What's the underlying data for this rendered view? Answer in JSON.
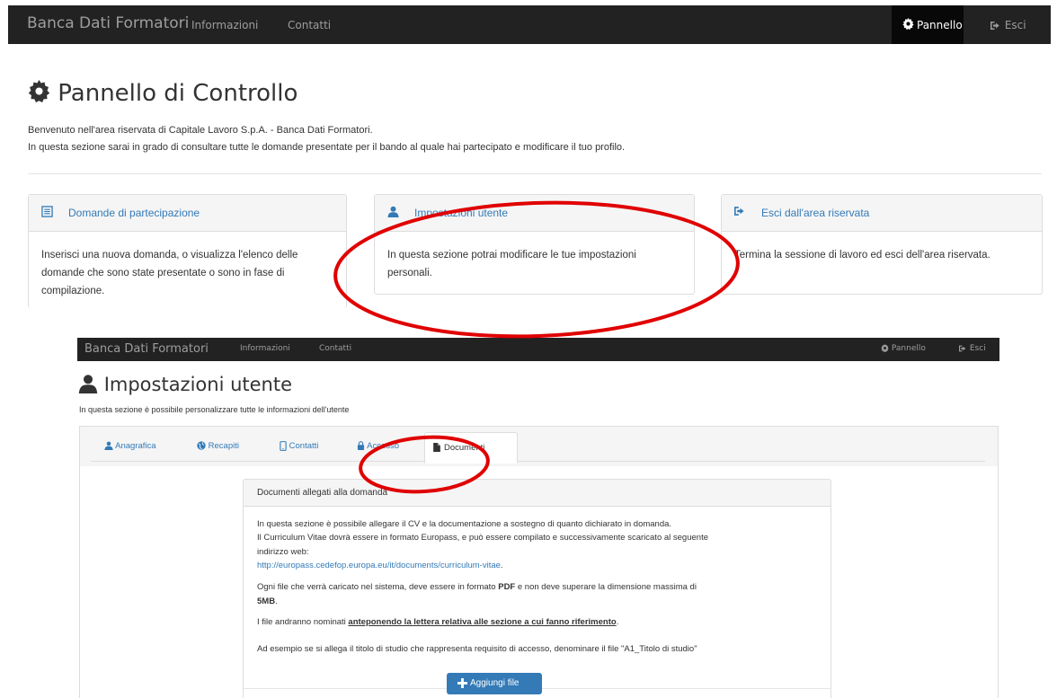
{
  "top": {
    "nav": {
      "brand": "Banca Dati Formatori",
      "links": [
        "Informazioni",
        "Contatti"
      ],
      "pannello": "Pannello",
      "esci": "Esci"
    },
    "title": "Pannello di Controllo",
    "intro_line1": "Benvenuto nell'area riservata di Capitale Lavoro S.p.A. - Banca Dati Formatori.",
    "intro_line2": "In questa sezione sarai in grado di consultare tutte le domande presentate per il bando al quale hai partecipato e modificare il tuo profilo.",
    "panels": [
      {
        "title": "Domande di partecipazione",
        "icon": "list-icon",
        "lines": [
          "Inserisci una nuova domanda, o visualizza l'elenco delle",
          "domande che sono state presentate o sono in fase di",
          "compilazione."
        ]
      },
      {
        "title": "Impostazioni utente",
        "icon": "user-icon",
        "lines": [
          "In questa sezione potrai modificare le tue impostazioni",
          "personali."
        ]
      },
      {
        "title": "Esci dall'area riservata",
        "icon": "logout-icon",
        "lines": [
          "Termina la sessione di lavoro ed esci dell'area riservata."
        ]
      }
    ]
  },
  "bottom": {
    "nav": {
      "brand": "Banca Dati Formatori",
      "links": [
        "Informazioni",
        "Contatti"
      ],
      "pannello": "Pannello",
      "esci": "Esci"
    },
    "title": "Impostazioni utente",
    "subtitle": "In questa sezione è possibile personalizzare tutte le informazioni dell'utente",
    "tabs": [
      "Anagrafica",
      "Recapiti",
      "Contatti",
      "Accesso",
      "Documenti"
    ],
    "active_tab": "Documenti",
    "doc_panel": {
      "title": "Documenti allegati alla domanda",
      "p1_line1": "In questa sezione è possibile allegare il CV e la documentazione a sostegno di quanto dichiarato in domanda.",
      "p1_line2": "Il Curriculum Vitae dovrà essere in formato Europass, e può essere compilato e successivamente scaricato al seguente",
      "p1_line3": "indirizzo web:",
      "link": "http://europass.cedefop.europa.eu/it/documents/curriculum-vitae",
      "link_suffix": ".",
      "p2_pre": "Ogni file che verrà caricato nel sistema, deve essere in formato ",
      "p2_bold": "PDF",
      "p2_post": " e non deve superare la dimensione massima di",
      "p2_size": "5MB",
      "p2_end": ".",
      "p3_pre": "I file andranno nominati ",
      "p3_bold": "anteponendo la lettera relativa alle sezione a cui fanno riferimento",
      "p3_end": ".",
      "p4": "Ad esempio se si allega il titolo di studio che rappresenta requisito di accesso, denominare il file \"A1_Titolo di studio\"",
      "add_button": "Aggiungi file"
    }
  },
  "colors": {
    "navbar": "#222222",
    "link": "#337ab7",
    "annotation": "#e00000",
    "button": "#337ab7"
  }
}
